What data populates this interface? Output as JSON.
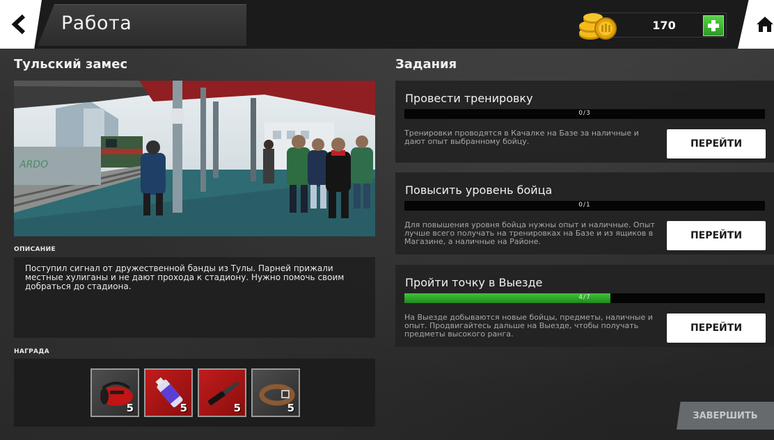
{
  "header": {
    "title": "Работа",
    "currency_amount": "170",
    "icons": [
      "back-arrow-icon",
      "coins-icon",
      "plus-icon",
      "home-icon"
    ]
  },
  "mission": {
    "title": "Тульский замес",
    "description_label": "ОПИСАНИЕ",
    "description": "Поступил сигнал от дружественной банды из Тулы. Парней прижали местные хулиганы и не дают прохода к стадиону. Нужно помочь своим добраться до стадиона.",
    "reward_label": "НАГРАДА",
    "rewards": [
      {
        "icon": "sports-bag-icon",
        "count": "5",
        "color": "#3a3a3a"
      },
      {
        "icon": "spray-can-icon",
        "count": "5",
        "color": "#b01616"
      },
      {
        "icon": "knife-icon",
        "count": "5",
        "color": "#b01616"
      },
      {
        "icon": "belt-icon",
        "count": "5",
        "color": "#3a3a3a"
      }
    ]
  },
  "tasks": {
    "title": "Задания",
    "items": [
      {
        "name": "Провести тренировку",
        "progress_label": "0/3",
        "progress": 0,
        "description": "Тренировки проводятся в Качалке на Базе за наличные и дают опыт выбранному бойцу.",
        "button_label": "ПЕРЕЙТИ"
      },
      {
        "name": "Повысить уровень бойца",
        "progress_label": "0/1",
        "progress": 0,
        "description": "Для повышения уровня бойца нужны опыт и наличные. Опыт лучше всего получать на тренировках на Базе и из ящиков в Магазине, а наличные на Районе.",
        "button_label": "ПЕРЕЙТИ"
      },
      {
        "name": "Пройти точку в Выезде",
        "progress_label": "4/7",
        "progress": 0.571,
        "description": "На Выезде добываются новые бойцы, предметы, наличные и опыт. Продвигайтесь дальше на Выезде, чтобы получать предметы высокого ранга.",
        "button_label": "ПЕРЕЙТИ"
      }
    ]
  },
  "finish_button_label": "ЗАВЕРШИТЬ",
  "colors": {
    "progress_fill": "#2fa82a",
    "add_button": "#3bb52e",
    "finish_disabled": "#787c80"
  }
}
